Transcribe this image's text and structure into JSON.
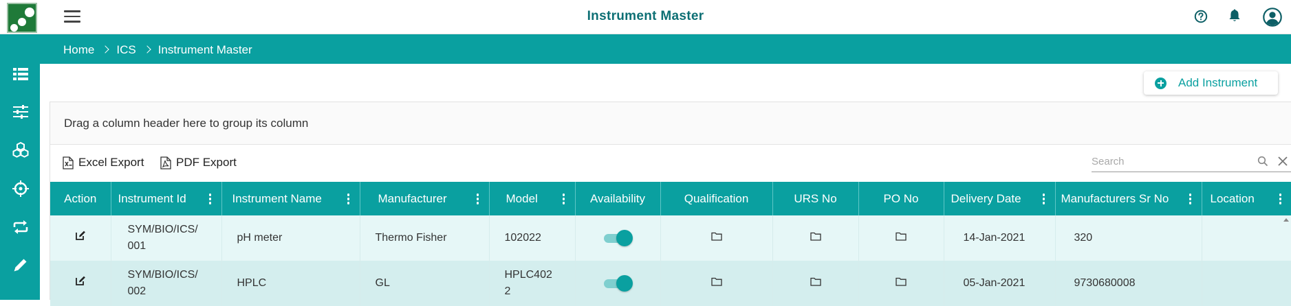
{
  "header": {
    "title": "Instrument Master",
    "logo": "app-logo",
    "icons": [
      "help-circle-icon",
      "bell-icon",
      "user-avatar-icon"
    ]
  },
  "sidebar": {
    "items": [
      "table-icon",
      "sliders-icon",
      "cubes-icon",
      "crosshair-icon",
      "repeat-icon",
      "pencil-icon"
    ]
  },
  "breadcrumb": [
    "Home",
    "ICS",
    "Instrument Master"
  ],
  "actions": {
    "add_label": "Add Instrument"
  },
  "grid": {
    "group_hint": "Drag a column header here to group its column",
    "excel_label": "Excel Export",
    "pdf_label": "PDF Export",
    "search_placeholder": "Search",
    "columns": [
      "Action",
      "Instrument Id",
      "Instrument Name",
      "Manufacturer",
      "Model",
      "Availability",
      "Qualification",
      "URS No",
      "PO No",
      "Delivery Date",
      "Manufacturers Sr No",
      "Location"
    ],
    "rows": [
      {
        "instrument_id": "SYM/BIO/ICS/\n001",
        "name": "pH meter",
        "manufacturer": "Thermo Fisher",
        "model": "102022",
        "available": true,
        "delivery_date": "14-Jan-2021",
        "sr_no": "320",
        "location": ""
      },
      {
        "instrument_id": "SYM/BIO/ICS/\n002",
        "name": "HPLC",
        "manufacturer": "GL",
        "model": "HPLC402\n2",
        "available": true,
        "delivery_date": "05-Jan-2021",
        "sr_no": "9730680008",
        "location": ""
      }
    ]
  },
  "colors": {
    "primary": "#0aa0a0",
    "title": "#0d6f74",
    "logo_green": "#1f7a39"
  }
}
